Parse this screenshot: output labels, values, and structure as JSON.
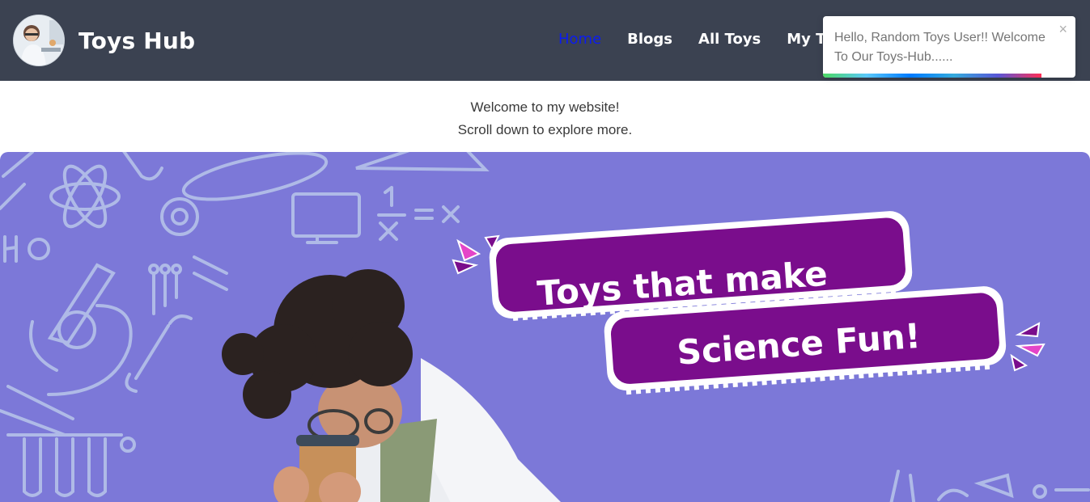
{
  "brand": {
    "name": "Toys Hub"
  },
  "nav": {
    "links": [
      "Home",
      "Blogs",
      "All Toys",
      "My Toys"
    ]
  },
  "toast": {
    "message": "Hello, Random Toys User!! Welcome To Our Toys-Hub......",
    "close": "×"
  },
  "welcome": {
    "line1": "Welcome to my website!",
    "line2": "Scroll down to explore more."
  },
  "banner": {
    "line1": "Toys that make",
    "line2": "Science Fun!"
  },
  "colors": {
    "navbar": "#3b4251",
    "active_link": "#0b1cf0",
    "banner_bg": "#7c78d8",
    "tag_bg": "#7a0d8c"
  },
  "icons": [
    "close-icon",
    "logo-avatar"
  ]
}
